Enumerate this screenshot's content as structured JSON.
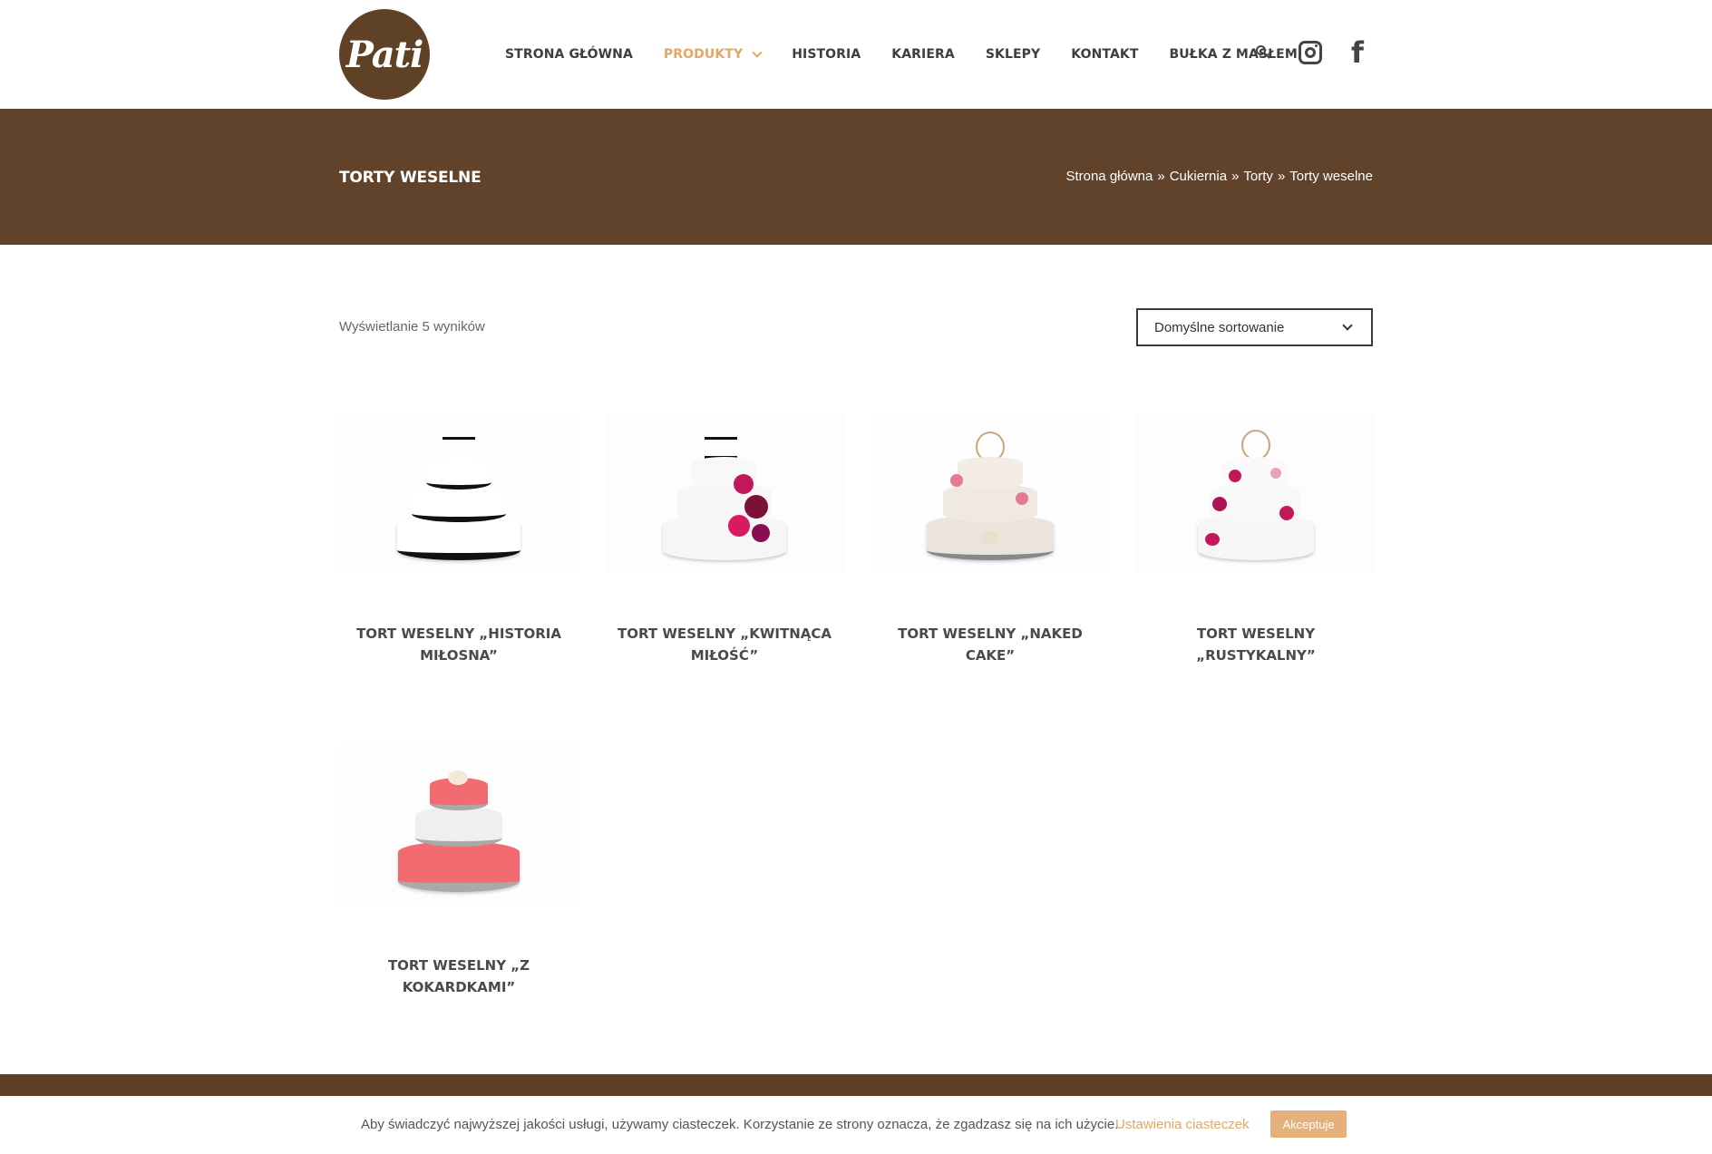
{
  "header": {
    "logo_text": "Pati",
    "nav": [
      {
        "label": "STRONA GŁÓWNA"
      },
      {
        "label": "PRODUKTY"
      },
      {
        "label": "HISTORIA"
      },
      {
        "label": "KARIERA"
      },
      {
        "label": "SKLEPY"
      },
      {
        "label": "KONTAKT"
      },
      {
        "label": "BUŁKA Z MASŁEM"
      }
    ],
    "icons": [
      "search-icon",
      "instagram-icon",
      "facebook-icon"
    ],
    "facebook_glyph": "f"
  },
  "title_band": {
    "title": "TORTY WESELNE",
    "breadcrumb": [
      "Strona główna",
      "Cukiernia",
      "Torty",
      "Torty weselne"
    ],
    "separator": "»"
  },
  "toolbar": {
    "result_count": "Wyświetlanie 5 wyników",
    "sort_value": "Domyślne sortowanie"
  },
  "products": [
    {
      "title": "TORT WESELNY „HISTORIA MIŁOSNA”"
    },
    {
      "title": "TORT WESELNY „KWITNĄCA MIŁOŚĆ”"
    },
    {
      "title": "TORT WESELNY „NAKED CAKE”"
    },
    {
      "title": "TORT WESELNY „RUSTYKALNY”"
    },
    {
      "title": "TORT WESELNY „Z KOKARDKAMI”"
    }
  ],
  "cookie": {
    "text": "Aby świadczyć najwyższej jakości usługi, używamy ciasteczek. Korzystanie ze strony oznacza, że zgadzasz się na ich użycie.",
    "settings_link": "Ustawienia ciasteczek",
    "accept_button": "Akceptuje"
  },
  "colors": {
    "brand_brown": "#60432a",
    "accent": "#e0a766",
    "text_dark": "#3e3e3e"
  }
}
